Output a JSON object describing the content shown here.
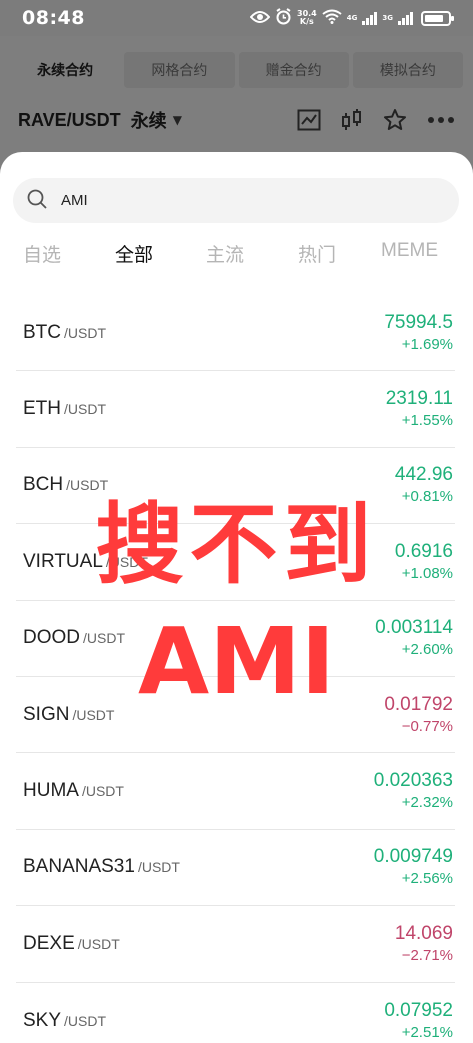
{
  "status_bar": {
    "time": "08:48",
    "net_speed_value": "30.4",
    "net_speed_unit": "K/s",
    "sim1_label": "4G",
    "sim2_label": "3G"
  },
  "background": {
    "tabs": [
      {
        "label": "永续合约"
      },
      {
        "label": "网格合约"
      },
      {
        "label": "赠金合约"
      },
      {
        "label": "模拟合约"
      }
    ],
    "pair": "RAVE/USDT",
    "contract_type": "永续"
  },
  "search": {
    "value": "AMI",
    "placeholder": ""
  },
  "categories": [
    {
      "label": "自选"
    },
    {
      "label": "全部"
    },
    {
      "label": "主流"
    },
    {
      "label": "热门"
    },
    {
      "label": "MEME"
    }
  ],
  "list": [
    {
      "symbol": "BTC",
      "quote": "/USDT",
      "price": "75994.5",
      "change": "+1.69%",
      "dir": "up"
    },
    {
      "symbol": "ETH",
      "quote": "/USDT",
      "price": "2319.11",
      "change": "+1.55%",
      "dir": "up"
    },
    {
      "symbol": "BCH",
      "quote": "/USDT",
      "price": "442.96",
      "change": "+0.81%",
      "dir": "up"
    },
    {
      "symbol": "VIRTUAL",
      "quote": "/USDT",
      "price": "0.6916",
      "change": "+1.08%",
      "dir": "up"
    },
    {
      "symbol": "DOOD",
      "quote": "/USDT",
      "price": "0.003114",
      "change": "+2.60%",
      "dir": "up"
    },
    {
      "symbol": "SIGN",
      "quote": "/USDT",
      "price": "0.01792",
      "change": "−0.77%",
      "dir": "down"
    },
    {
      "symbol": "HUMA",
      "quote": "/USDT",
      "price": "0.020363",
      "change": "+2.32%",
      "dir": "up"
    },
    {
      "symbol": "BANANAS31",
      "quote": "/USDT",
      "price": "0.009749",
      "change": "+2.56%",
      "dir": "up"
    },
    {
      "symbol": "DEXE",
      "quote": "/USDT",
      "price": "14.069",
      "change": "−2.71%",
      "dir": "down"
    },
    {
      "symbol": "SKY",
      "quote": "/USDT",
      "price": "0.07952",
      "change": "+2.51%",
      "dir": "up"
    }
  ],
  "overlay": {
    "line1": "搜不到",
    "line2": "AMI"
  },
  "colors": {
    "up": "#1fb07a",
    "down": "#c0456a",
    "overlay": "#ff3b3b"
  }
}
